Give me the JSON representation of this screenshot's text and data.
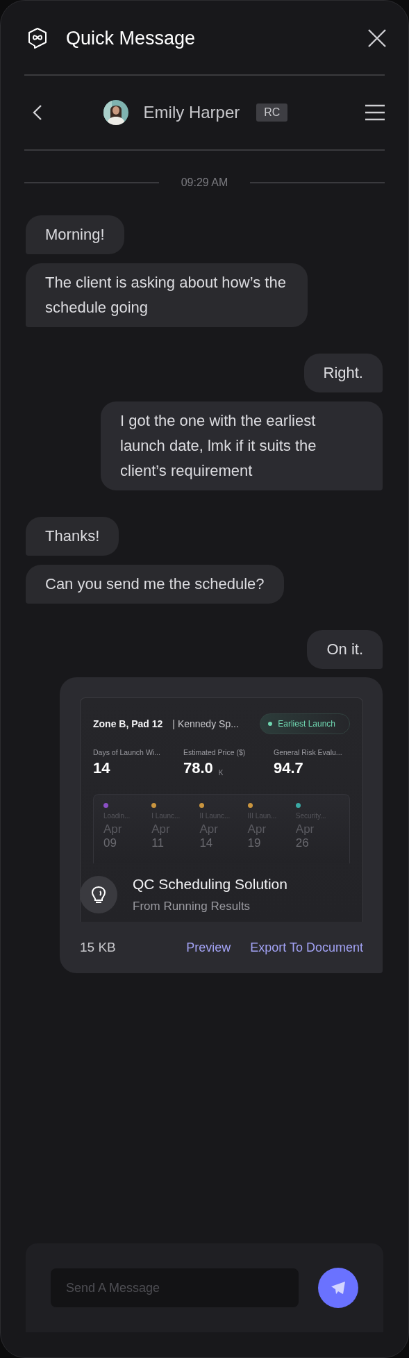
{
  "window": {
    "title": "Quick Message"
  },
  "contact": {
    "name": "Emily Harper",
    "tag": "RC"
  },
  "timestamp": "09:29 AM",
  "messages": [
    {
      "outgoing": false,
      "text": "Morning!"
    },
    {
      "outgoing": false,
      "text": "The client is asking about how’s the schedule going"
    },
    {
      "outgoing": true,
      "text": "Right."
    },
    {
      "outgoing": true,
      "text": "I got the one with the earliest launch date, lmk if it suits the client’s requirement"
    },
    {
      "outgoing": false,
      "text": "Thanks!"
    },
    {
      "outgoing": false,
      "text": "Can you send me the schedule?"
    },
    {
      "outgoing": true,
      "text": "On it."
    }
  ],
  "attachment": {
    "outgoing": true,
    "preview": {
      "zone": "Zone B, Pad 12",
      "site": "| Kennedy Sp...",
      "badge": "Earliest Launch",
      "metrics": [
        {
          "label": "Days of Launch Wi...",
          "value": "14"
        },
        {
          "label": "Estimated Price ($)",
          "value": "78.0",
          "unit": "K"
        },
        {
          "label": "General Risk Evalu...",
          "value": "94.7"
        }
      ],
      "milestones": [
        {
          "label": "Loadin...",
          "month": "Apr",
          "day": "09",
          "color": "#8a4fc4"
        },
        {
          "label": "I Launc...",
          "month": "Apr",
          "day": "11",
          "color": "#c9953f"
        },
        {
          "label": "II Launc...",
          "month": "Apr",
          "day": "14",
          "color": "#c9953f"
        },
        {
          "label": "III Laun...",
          "month": "Apr",
          "day": "19",
          "color": "#c9953f"
        },
        {
          "label": "Security...",
          "month": "Apr",
          "day": "26",
          "color": "#3aa9a4"
        }
      ]
    },
    "title": "QC Scheduling Solution",
    "subtitle": "From Running Results",
    "size": "15 KB",
    "actions": [
      "Preview",
      "Export To Document"
    ]
  },
  "composer": {
    "placeholder": "Send A Message"
  }
}
